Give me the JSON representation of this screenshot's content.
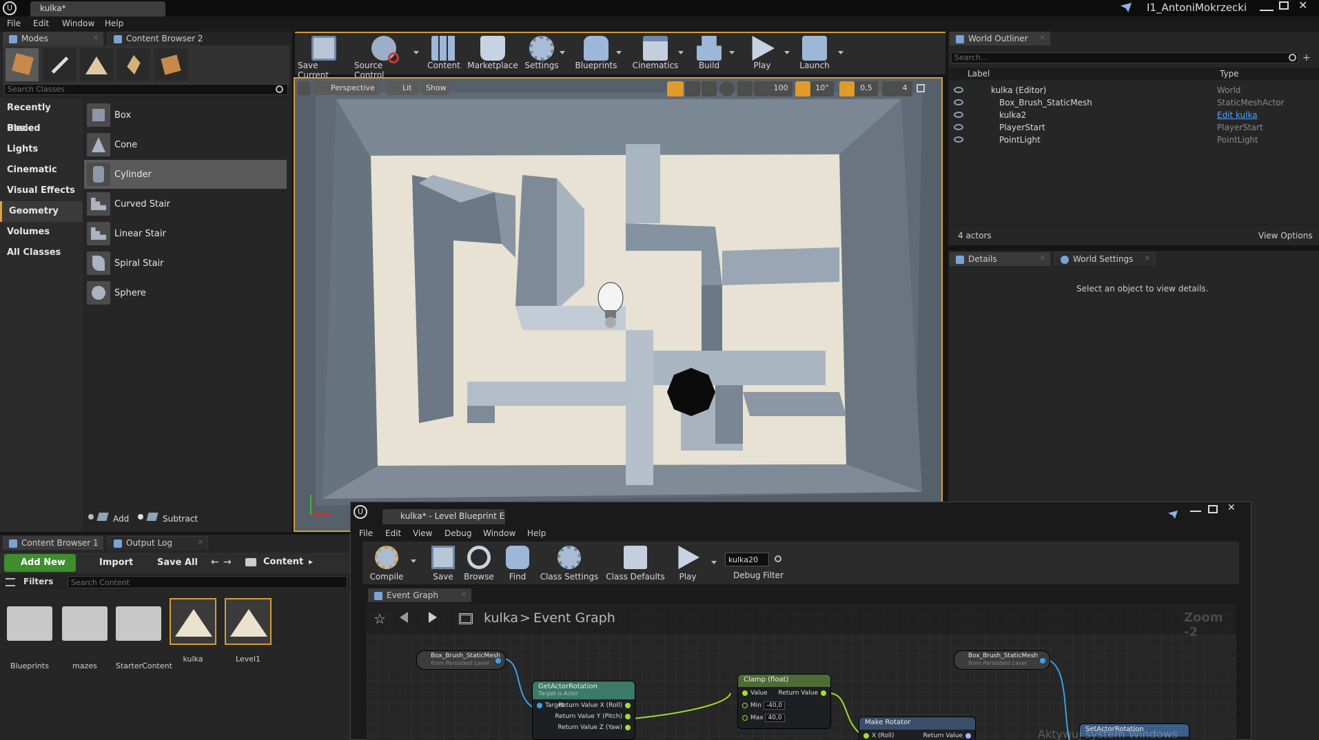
{
  "titlebar": {
    "tab_label": "kulka*",
    "user": "I1_AntoniMokrzecki"
  },
  "menu": [
    "File",
    "Edit",
    "Window",
    "Help"
  ],
  "tabs": {
    "modes": "Modes",
    "content_browser_2": "Content Browser 2",
    "world_outliner": "World Outliner",
    "details": "Details",
    "world_settings": "World Settings",
    "content_browser_1": "Content Browser 1",
    "output_log": "Output Log"
  },
  "modes": {
    "search_placeholder": "Search Classes",
    "categories": [
      "Recently Placed",
      "Basic",
      "Lights",
      "Cinematic",
      "Visual Effects",
      "Geometry",
      "Volumes",
      "All Classes"
    ],
    "selected_category": "Geometry",
    "items": [
      "Box",
      "Cone",
      "Cylinder",
      "Curved Stair",
      "Linear Stair",
      "Spiral Stair",
      "Sphere"
    ],
    "selected_item": "Cylinder",
    "add": "Add",
    "subtract": "Subtract"
  },
  "toolbar": [
    "Save Current",
    "Source Control",
    "Content",
    "Marketplace",
    "Settings",
    "Blueprints",
    "Cinematics",
    "Build",
    "Play",
    "Launch"
  ],
  "viewport": {
    "perspective": "Perspective",
    "lit": "Lit",
    "show": "Show",
    "grid": "100",
    "angle": "10°",
    "scale": "0,5",
    "speed": "4"
  },
  "outliner": {
    "search_placeholder": "Search...",
    "col_label": "Label",
    "col_type": "Type",
    "rows": [
      {
        "name": "kulka (Editor)",
        "type": "World"
      },
      {
        "name": "Box_Brush_StaticMesh",
        "type": "StaticMeshActor"
      },
      {
        "name": "kulka2",
        "type": "Edit kulka"
      },
      {
        "name": "PlayerStart",
        "type": "PlayerStart"
      },
      {
        "name": "PointLight",
        "type": "PointLight"
      }
    ],
    "actors": "4 actors",
    "view_options": "View Options"
  },
  "details": {
    "empty": "Select an object to view details."
  },
  "content_browser": {
    "add_new": "Add New",
    "import": "Import",
    "save_all": "Save All",
    "path": "Content",
    "filters": "Filters",
    "search_placeholder": "Search Content",
    "assets": [
      "Blueprints",
      "mazes",
      "StarterContent",
      "kulka",
      "Level1"
    ]
  },
  "blueprint": {
    "title": "kulka* - Level Blueprint Ec",
    "menu": [
      "File",
      "Edit",
      "View",
      "Debug",
      "Window",
      "Help"
    ],
    "toolbar": [
      "Compile",
      "Save",
      "Browse",
      "Find",
      "Class Settings",
      "Class Defaults",
      "Play"
    ],
    "debug_value": "kulka20",
    "debug_filter": "Debug Filter",
    "graph_tab": "Event Graph",
    "breadcrumb_root": "kulka",
    "breadcrumb_sep": ">",
    "breadcrumb_leaf": "Event Graph",
    "zoom": "Zoom -2",
    "watermark": "Aktywuj system Windows",
    "nodes": {
      "ref1_title": "Box_Brush_StaticMesh",
      "ref1_sub": "from Persistent Level",
      "getrot_title": "GetActorRotation",
      "getrot_sub": "Target is Actor",
      "getrot_target": "Target",
      "getrot_outs": [
        "Return Value X (Roll)",
        "Return Value Y (Pitch)",
        "Return Value Z (Yaw)"
      ],
      "clamp_title": "Clamp (float)",
      "clamp_value": "Value",
      "clamp_return": "Return Value",
      "clamp_min_label": "Min",
      "clamp_min": "-40,0",
      "clamp_max_label": "Max",
      "clamp_max": "40,0",
      "ref2_title": "Box_Brush_StaticMesh",
      "ref2_sub": "from Persistent Level",
      "makerot_title": "Make Rotator",
      "makerot_x": "X (Roll)",
      "makerot_ret": "Return Value",
      "setrot_title": "SetActorRotation"
    }
  }
}
